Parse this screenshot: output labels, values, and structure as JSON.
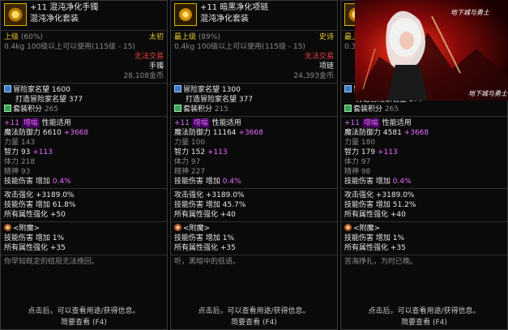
{
  "tooltips": [
    {
      "title_plus": "+11",
      "title_name": "混沌净化手镯",
      "set_name": "混沌净化套装",
      "grade": "上级",
      "grade_pct": "(60%)",
      "rarity": "太初",
      "weight": "0.4kg",
      "level_req": "100级以上可以使用(115级 - 15)",
      "trade": "无法交易",
      "slot": "手镯",
      "price": "28,108金币",
      "fame_label": "冒险家名望",
      "fame": "1600",
      "forge_fame_label": "打造冒险家名望",
      "forge_fame": "377",
      "set_points_label": "套装积分",
      "set_points": "265",
      "enhance_plus": "+11",
      "enhance_word": "增幅",
      "perf": "性能适用",
      "def_label": "魔法防御力",
      "def": "6610",
      "def_bonus": "+3668",
      "str_label": "力量",
      "str": "143",
      "int_label": "智力",
      "int": "93",
      "int_bonus": "+113",
      "vit_label": "体力",
      "vit": "218",
      "spi_label": "精神",
      "spi": "93",
      "skill_dmg_label": "技能伤害",
      "skill_dmg_inc": "增加",
      "skill_dmg": "0.4%",
      "atk_label": "攻击强化",
      "atk": "+3189.0%",
      "skill_dmg2_label": "技能伤害",
      "skill_dmg2_inc": "增加",
      "skill_dmg2": "61.8%",
      "all_elem_label": "所有属性强化",
      "all_elem": "+50",
      "enchant_label": "<附魔>",
      "ench_skill_label": "技能伤害",
      "ench_skill_inc": "增加",
      "ench_skill": "1%",
      "ench_elem_label": "所有属性强化",
      "ench_elem": "+35",
      "flavor": "你早知既定的结局无法挽回。",
      "foot1": "点击后，可以查看用途/获得信息。",
      "foot2": "简要查看 (F4)"
    },
    {
      "title_plus": "+11",
      "title_name": "暗黑净化项链",
      "set_name": "混沌净化套装",
      "grade": "最上级",
      "grade_pct": "(89%)",
      "rarity": "史诗",
      "weight": "0.4kg",
      "level_req": "100级以上可以使用(115级 - 15)",
      "trade": "无法交易",
      "slot": "项链",
      "price": "24,393金币",
      "fame_label": "冒险家名望",
      "fame": "1300",
      "forge_fame_label": "打造冒险家名望",
      "forge_fame": "377",
      "set_points_label": "套装积分",
      "set_points": "215",
      "enhance_plus": "+11",
      "enhance_word": "增幅",
      "perf": "性能适用",
      "def_label": "魔法防御力",
      "def": "11164",
      "def_bonus": "+3668",
      "str_label": "力量",
      "str": "100",
      "int_label": "智力",
      "int": "152",
      "int_bonus": "+113",
      "vit_label": "体力",
      "vit": "97",
      "spi_label": "精神",
      "spi": "227",
      "skill_dmg_label": "技能伤害",
      "skill_dmg_inc": "增加",
      "skill_dmg": "0.4%",
      "atk_label": "攻击强化",
      "atk": "+3189.0%",
      "skill_dmg2_label": "技能伤害",
      "skill_dmg2_inc": "增加",
      "skill_dmg2": "45.7%",
      "all_elem_label": "所有属性强化",
      "all_elem": "+40",
      "enchant_label": "<附魔>",
      "ench_skill_label": "技能伤害",
      "ench_skill_inc": "增加",
      "ench_skill": "1%",
      "ench_elem_label": "所有属性强化",
      "ench_elem": "+35",
      "flavor": "听，黑暗中的低语。",
      "foot1": "点击后，可以查看用途/获得信息。",
      "foot2": "简要查看 (F4)"
    },
    {
      "title_plus": "",
      "title_name": "",
      "set_name": "",
      "grade": "最上",
      "grade_pct": "",
      "rarity": "",
      "weight": "0.3k",
      "level_req": "",
      "trade": "",
      "slot": "",
      "price": "",
      "fame_label": "冒险家名望",
      "fame": "1600",
      "forge_fame_label": "打造冒险家名望",
      "forge_fame": "377",
      "set_points_label": "套装积分",
      "set_points": "265",
      "enhance_plus": "+11",
      "enhance_word": "增幅",
      "perf": "性能适用",
      "def_label": "魔法防御力",
      "def": "4581",
      "def_bonus": "+3668",
      "str_label": "力量",
      "str": "180",
      "int_label": "智力",
      "int": "179",
      "int_bonus": "+113",
      "vit_label": "体力",
      "vit": "97",
      "spi_label": "精神",
      "spi": "98",
      "skill_dmg_label": "技能伤害",
      "skill_dmg_inc": "增加",
      "skill_dmg": "0.4%",
      "atk_label": "攻击强化",
      "atk": "+3189.0%",
      "skill_dmg2_label": "技能伤害",
      "skill_dmg2_inc": "增加",
      "skill_dmg2": "51.2%",
      "all_elem_label": "所有属性强化",
      "all_elem": "+40",
      "enchant_label": "<附魔>",
      "ench_skill_label": "技能伤害",
      "ench_skill_inc": "增加",
      "ench_skill": "1%",
      "ench_elem_label": "所有属性强化",
      "ench_elem": "+35",
      "flavor": "苦海挣扎，为时已晚。",
      "foot1": "点击后，可以查看用途/获得信息。",
      "foot2": "简要查看 (F4)"
    }
  ],
  "banner": {
    "logo_left": "地下城与勇士",
    "logo_right": "地下城与勇士"
  },
  "colors": {
    "gold_border": "#d4b300",
    "rarity_primal": "#e8c830",
    "rarity_epic": "#e8c830",
    "untradeable": "#e84040",
    "green_bonus": "#8cd850",
    "enhance_purple": "#d86cff"
  }
}
